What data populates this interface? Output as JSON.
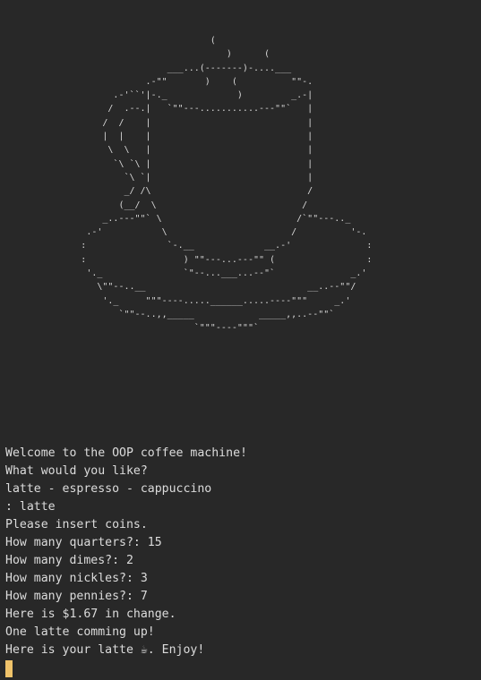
{
  "ascii_art": "                                       (\n                                          )      (\n                               ___...(-------)-....___\n                           .-\"\"       )    (          \"\"-.\n                     .-'``'|-._             )         _.-|\n                    /  .--.|   `\"\"---...........---\"\"`   |\n                   /  /    |                             |\n                   |  |    |                             |\n                    \\  \\   |                             |\n                     `\\ `\\ |                             |\n                       `\\ `|                             |\n                       _/ /\\                             /\n                      (__/  \\                           /\n                   _..---\"\"` \\                         /`\"\"---.._\n                .-'           \\                       /          '-.\n               :               `-.__             __.-'              :\n               :                  ) \"\"---...---\"\" (                 :\n                '._               `\"--...___...--\"`              _.'\n                  \\\"\"--..__                              __..--\"\"/\n                   '._     \"\"\"----.....______.....----\"\"\"     _.'\n                      `\"\"--..,,_____            _____,,..--\"\"`\n                                    `\"\"\"----\"\"\"`",
  "output_lines": [
    "Welcome to the OOP coffee machine!",
    "What would you like?",
    "latte - espresso - cappuccino",
    ": latte",
    "Please insert coins.",
    "How many quarters?: 15",
    "How many dimes?: 2",
    "How many nickles?: 3",
    "How many pennies?: 7",
    "Here is $1.67 in change.",
    "One latte comming up!",
    "Here is your latte ☕. Enjoy!"
  ],
  "colors": {
    "background": "#282828",
    "text": "#dcdcdc",
    "cursor": "#f0c36a"
  }
}
